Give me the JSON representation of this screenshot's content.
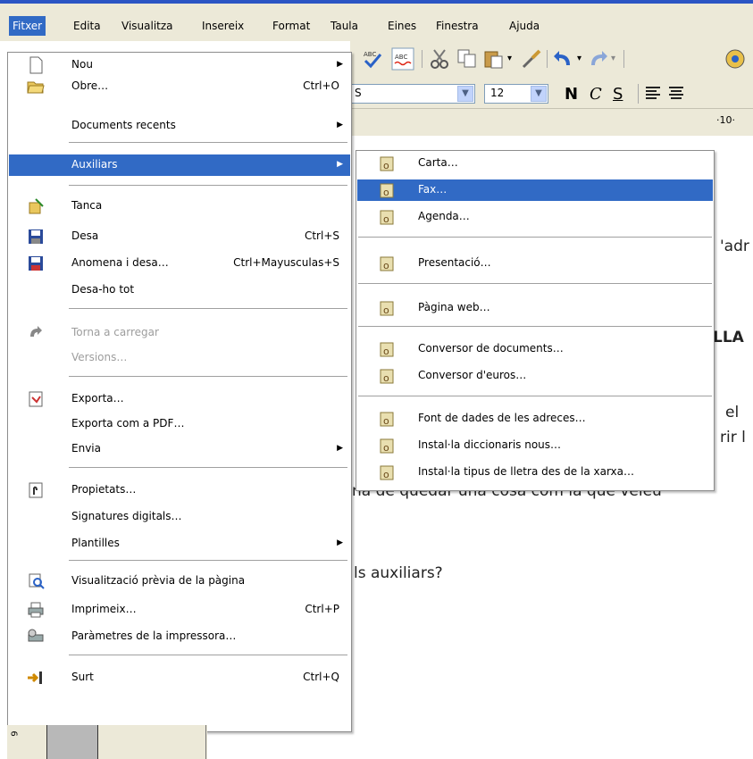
{
  "menubar": {
    "items": [
      "Fitxer",
      "Edita",
      "Visualitza",
      "Insereix",
      "Format",
      "Taula",
      "Eines",
      "Finestra",
      "Ajuda"
    ]
  },
  "toolbar": {
    "font_name_partial": "S",
    "font_size": "12",
    "bold": "N",
    "italic": "C",
    "underline": "S"
  },
  "ruler": {
    "mark": "·10·"
  },
  "doc_fragments": {
    "adr": "'adr",
    "lla": "LLA",
    "el": "el",
    "rir": "rir l",
    "line": "na de quedar una cosa com la que veieu",
    "question": "ls auxiliars?"
  },
  "file_menu": {
    "items": [
      {
        "label": "Nou",
        "shortcut": "",
        "submenu": true,
        "icon": "new-document-icon"
      },
      {
        "label": "Obre…",
        "shortcut": "Ctrl+O",
        "icon": "open-folder-icon"
      },
      {
        "label": "Documents recents",
        "shortcut": "",
        "submenu": true,
        "icon": ""
      },
      {
        "label": "Auxiliars",
        "shortcut": "",
        "submenu": true,
        "highlighted": true,
        "icon": ""
      },
      {
        "label": "Tanca",
        "shortcut": "",
        "icon": "close-document-icon"
      },
      {
        "label": "Desa",
        "shortcut": "Ctrl+S",
        "icon": "save-disk-icon"
      },
      {
        "label": "Anomena i desa…",
        "shortcut": "Ctrl+Mayusculas+S",
        "icon": "save-as-disk-icon"
      },
      {
        "label": "Desa-ho tot",
        "shortcut": "",
        "icon": ""
      },
      {
        "label": "Torna a carregar",
        "shortcut": "",
        "disabled": true,
        "icon": "reload-icon"
      },
      {
        "label": "Versions…",
        "shortcut": "",
        "disabled": true,
        "icon": ""
      },
      {
        "label": "Exporta…",
        "shortcut": "",
        "icon": "export-icon"
      },
      {
        "label": "Exporta com a PDF…",
        "shortcut": "",
        "icon": ""
      },
      {
        "label": "Envia",
        "shortcut": "",
        "submenu": true,
        "icon": ""
      },
      {
        "label": "Propietats…",
        "shortcut": "",
        "icon": "properties-icon"
      },
      {
        "label": "Signatures digitals…",
        "shortcut": "",
        "icon": ""
      },
      {
        "label": "Plantilles",
        "shortcut": "",
        "submenu": true,
        "icon": ""
      },
      {
        "label": "Visualització prèvia de la pàgina",
        "shortcut": "",
        "icon": "print-preview-icon"
      },
      {
        "label": "Imprimeix…",
        "shortcut": "Ctrl+P",
        "icon": "printer-icon"
      },
      {
        "label": "Paràmetres de la impressora…",
        "shortcut": "",
        "icon": "printer-settings-icon"
      },
      {
        "label": "Surt",
        "shortcut": "Ctrl+Q",
        "icon": "exit-icon"
      }
    ]
  },
  "wizards_menu": {
    "items": [
      {
        "label": "Carta…"
      },
      {
        "label": "Fax…",
        "highlighted": true
      },
      {
        "label": "Agenda…"
      },
      {
        "label": "Presentació…"
      },
      {
        "label": "Pàgina web…"
      },
      {
        "label": "Conversor de documents…"
      },
      {
        "label": "Conversor d'euros…"
      },
      {
        "label": "Font de dades de les adreces…"
      },
      {
        "label": "Instal·la diccionaris nous…"
      },
      {
        "label": "Instal·la tipus de lletra des de la xarxa…"
      }
    ]
  },
  "bottom": {
    "ruler_number": "9"
  },
  "colors": {
    "menu_highlight": "#316ac5",
    "menubar_bg": "#ece9d8",
    "title_bar_edge": "#2b55c4"
  }
}
